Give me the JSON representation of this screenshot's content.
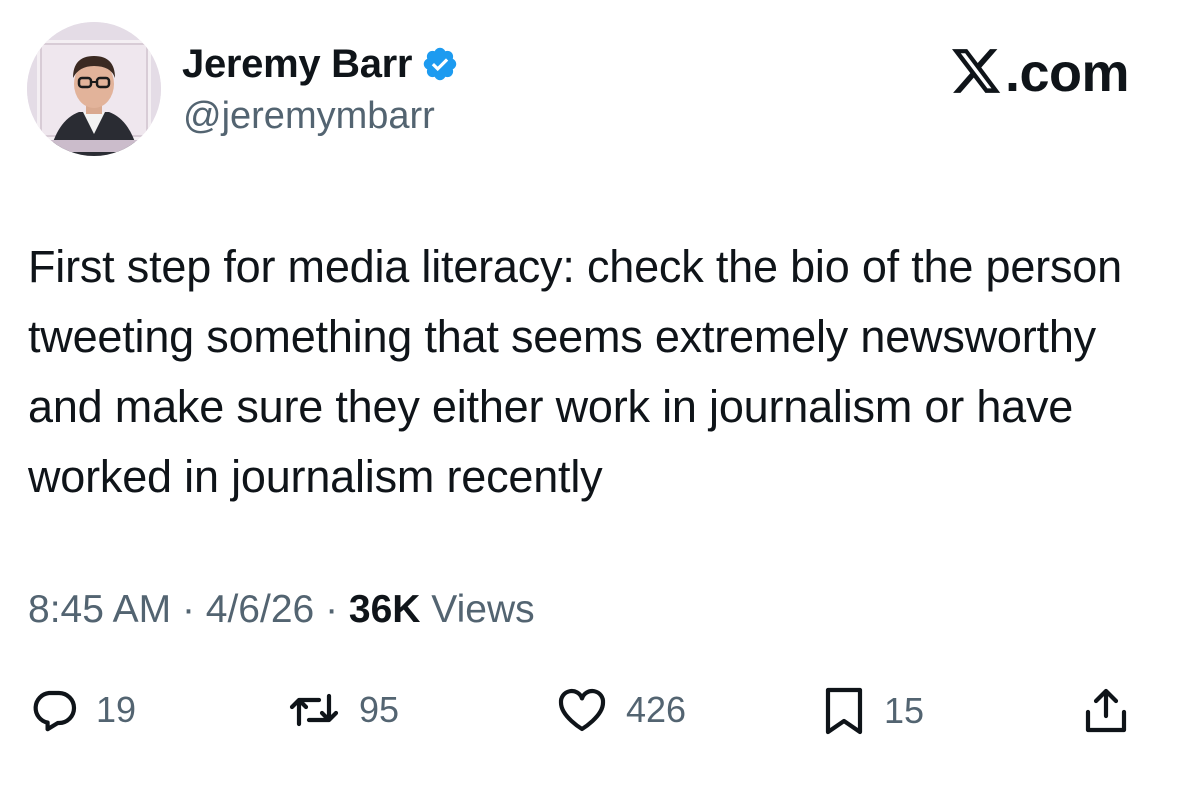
{
  "author": {
    "name": "Jeremy Barr",
    "handle": "@jeremymbarr",
    "verified": true
  },
  "brand": {
    "text": ".com",
    "logo": "x-logo-icon"
  },
  "tweet": {
    "text": "First step for media literacy: check the bio of the person tweeting something that seems extremely newsworthy and make sure they either work in journalism or have worked in journalism recently"
  },
  "meta": {
    "time": "8:45 AM",
    "separator": "·",
    "date": "4/6/26",
    "views_count": "36K",
    "views_label": "Views"
  },
  "actions": {
    "replies": "19",
    "reposts": "95",
    "likes": "426",
    "bookmarks": "15"
  },
  "colors": {
    "text_primary": "#0f1419",
    "text_secondary": "#536471",
    "verified_blue": "#1d9bf0",
    "background": "#ffffff"
  }
}
